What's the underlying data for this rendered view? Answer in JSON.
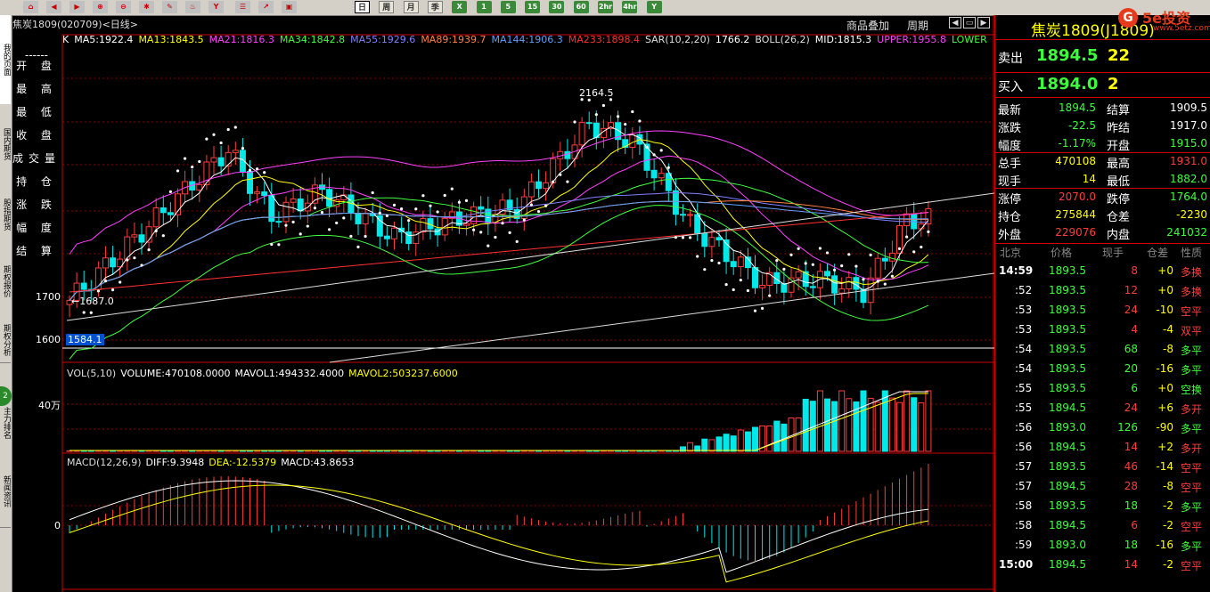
{
  "toolbar": {
    "icons": [
      "home-icon",
      "back-icon",
      "forward-icon",
      "zoom-in-icon",
      "zoom-out-icon",
      "settings-icon",
      "pen-icon",
      "brush-icon",
      "cup-icon",
      "list-icon",
      "chart-icon",
      "tick-icon"
    ],
    "periods": [
      "日",
      "周",
      "月",
      "季",
      "X",
      "1",
      "5",
      "15",
      "30",
      "60",
      "2hr",
      "4hr",
      "Y"
    ],
    "active_period": "日",
    "tick_label": "tick"
  },
  "left_tabs": [
    "我的页面",
    "国内期货",
    "股指期货",
    "期权报价",
    "期权分析",
    "",
    "主力排名",
    "新闻资讯"
  ],
  "left_badge": "2",
  "chart": {
    "title": "焦炭1809(020709)<日线>",
    "overlay_link": "商品叠加",
    "cycle_link": "周期",
    "indicators": [
      {
        "text": "K",
        "color": "#ffffff"
      },
      {
        "text": "MA5:1922.4",
        "color": "#ffffff"
      },
      {
        "text": "MA13:1843.5",
        "color": "#ffff00"
      },
      {
        "text": "MA21:1816.3",
        "color": "#ff40ff"
      },
      {
        "text": "MA34:1842.8",
        "color": "#40ff40"
      },
      {
        "text": "MA55:1929.6",
        "color": "#8080ff"
      },
      {
        "text": "MA89:1939.7",
        "color": "#ff8040"
      },
      {
        "text": "MA144:1906.3",
        "color": "#60a0ff"
      },
      {
        "text": "MA233:1898.4",
        "color": "#ff3030"
      },
      {
        "text": "SAR(10,2,20)",
        "color": "#dddddd"
      },
      {
        "text": "1766.2",
        "color": "#ffffff"
      },
      {
        "text": "BOLL(26,2)",
        "color": "#dddddd"
      },
      {
        "text": "MID:1815.3",
        "color": "#ffffff"
      },
      {
        "text": "UPPER:1955.8",
        "color": "#ff40ff"
      },
      {
        "text": "LOWER",
        "color": "#40ff40"
      }
    ],
    "ohlc_labels": [
      "------",
      "开 盘",
      "最 高",
      "最 低",
      "收 盘",
      "成交量",
      "持 仓",
      "涨 跌",
      "幅 度",
      "结 算"
    ],
    "y_labels": [
      "1700",
      "1600"
    ],
    "annotations": {
      "high": "2164.5",
      "low": "←1687.0",
      "cursor_price": "1584.1"
    },
    "vol_label": [
      {
        "text": "VOL(5,10)",
        "color": "#dddddd"
      },
      {
        "text": "VOLUME:470108.0000",
        "color": "#ffffff"
      },
      {
        "text": "MAVOL1:494332.4000",
        "color": "#ffffff"
      },
      {
        "text": "MAVOL2:503237.6000",
        "color": "#ffff00"
      }
    ],
    "vol_y_label": "40万",
    "macd_label": [
      {
        "text": "MACD(12,26,9)",
        "color": "#dddddd"
      },
      {
        "text": "DIFF:9.3948",
        "color": "#ffffff"
      },
      {
        "text": "DEA:-12.5379",
        "color": "#ffff00"
      },
      {
        "text": "MACD:43.8653",
        "color": "#ffffff"
      }
    ],
    "macd_y_label": "0"
  },
  "quote": {
    "title": "焦炭1809(J1809)",
    "sell_label": "卖出",
    "sell_price": "1894.5",
    "sell_vol": "22",
    "buy_label": "买入",
    "buy_price": "1894.0",
    "buy_vol": "2",
    "rows": [
      {
        "l1": "最新",
        "v1": "1894.5",
        "c1": "#3cff3c",
        "l2": "结算",
        "v2": "1909.5",
        "c2": "#ffffff"
      },
      {
        "l1": "涨跌",
        "v1": "-22.5",
        "c1": "#3cff3c",
        "l2": "昨结",
        "v2": "1917.0",
        "c2": "#ffffff"
      },
      {
        "l1": "幅度",
        "v1": "-1.17%",
        "c1": "#3cff3c",
        "l2": "开盘",
        "v2": "1915.0",
        "c2": "#3cff3c"
      },
      {
        "l1": "总手",
        "v1": "470108",
        "c1": "#ffff00",
        "l2": "最高",
        "v2": "1931.0",
        "c2": "#ff3c3c"
      },
      {
        "l1": "现手",
        "v1": "14",
        "c1": "#ffff00",
        "l2": "最低",
        "v2": "1882.0",
        "c2": "#3cff3c"
      },
      {
        "l1": "涨停",
        "v1": "2070.0",
        "c1": "#ff3c3c",
        "l2": "跌停",
        "v2": "1764.0",
        "c2": "#3cff3c"
      },
      {
        "l1": "持仓",
        "v1": "275844",
        "c1": "#ffff00",
        "l2": "仓差",
        "v2": "-2230",
        "c2": "#ffff00"
      },
      {
        "l1": "外盘",
        "v1": "229076",
        "c1": "#ff3c3c",
        "l2": "内盘",
        "v2": "241032",
        "c2": "#3cff3c"
      }
    ],
    "tick_headers": [
      "北京",
      "价格",
      "现手",
      "仓差",
      "性质"
    ],
    "ticks": [
      {
        "t": "14:59",
        "p": "1893.5",
        "pc": "#3cff3c",
        "v": "8",
        "o": "+0",
        "k": "多换",
        "kc": "#ff3c3c"
      },
      {
        "t": ":52",
        "p": "1893.5",
        "pc": "#3cff3c",
        "v": "12",
        "o": "+0",
        "k": "多换",
        "kc": "#ff3c3c"
      },
      {
        "t": ":53",
        "p": "1893.5",
        "pc": "#3cff3c",
        "v": "24",
        "o": "-10",
        "k": "空平",
        "kc": "#ff3c3c"
      },
      {
        "t": ":53",
        "p": "1893.5",
        "pc": "#3cff3c",
        "v": "4",
        "o": "-4",
        "k": "双平",
        "kc": "#ff3c3c"
      },
      {
        "t": ":54",
        "p": "1893.5",
        "pc": "#3cff3c",
        "v": "68",
        "o": "-8",
        "k": "多平",
        "kc": "#3cff3c"
      },
      {
        "t": ":54",
        "p": "1893.5",
        "pc": "#3cff3c",
        "v": "20",
        "o": "-16",
        "k": "多平",
        "kc": "#3cff3c"
      },
      {
        "t": ":55",
        "p": "1893.5",
        "pc": "#3cff3c",
        "v": "6",
        "o": "+0",
        "k": "空换",
        "kc": "#3cff3c"
      },
      {
        "t": ":55",
        "p": "1894.5",
        "pc": "#3cff3c",
        "v": "24",
        "o": "+6",
        "k": "多开",
        "kc": "#ff3c3c"
      },
      {
        "t": ":56",
        "p": "1893.0",
        "pc": "#3cff3c",
        "v": "126",
        "o": "-90",
        "k": "多平",
        "kc": "#3cff3c"
      },
      {
        "t": ":56",
        "p": "1894.5",
        "pc": "#3cff3c",
        "v": "14",
        "o": "+2",
        "k": "多开",
        "kc": "#ff3c3c"
      },
      {
        "t": ":57",
        "p": "1893.5",
        "pc": "#3cff3c",
        "v": "46",
        "o": "-14",
        "k": "空平",
        "kc": "#ff3c3c"
      },
      {
        "t": ":57",
        "p": "1894.5",
        "pc": "#3cff3c",
        "v": "28",
        "o": "-8",
        "k": "空平",
        "kc": "#ff3c3c"
      },
      {
        "t": ":58",
        "p": "1893.5",
        "pc": "#3cff3c",
        "v": "18",
        "o": "-2",
        "k": "多平",
        "kc": "#3cff3c"
      },
      {
        "t": ":58",
        "p": "1894.5",
        "pc": "#3cff3c",
        "v": "6",
        "o": "-2",
        "k": "空平",
        "kc": "#ff3c3c"
      },
      {
        "t": ":59",
        "p": "1893.0",
        "pc": "#3cff3c",
        "v": "18",
        "o": "-16",
        "k": "多平",
        "kc": "#3cff3c"
      },
      {
        "t": "15:00",
        "p": "1894.5",
        "pc": "#3cff3c",
        "v": "14",
        "o": "-2",
        "k": "空平",
        "kc": "#ff3c3c"
      }
    ]
  },
  "logo": {
    "text": "5e投资",
    "url": "www.5etz.com",
    "badge": "G"
  }
}
